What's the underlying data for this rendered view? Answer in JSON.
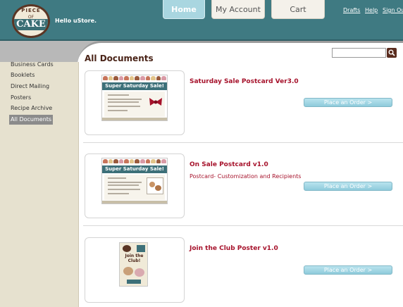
{
  "header": {
    "logo_top": "PIECE",
    "logo_mid": "OF",
    "logo_main": "CAKE",
    "greeting": "Hello uStore.",
    "tabs": [
      {
        "label": "Home"
      },
      {
        "label": "My Account"
      },
      {
        "label": "Cart"
      }
    ],
    "links": {
      "drafts": "Drafts",
      "help": "Help",
      "signout": "Sign Ou"
    }
  },
  "search": {
    "placeholder": ""
  },
  "sidebar": {
    "items": [
      {
        "label": "Business Cards"
      },
      {
        "label": "Booklets"
      },
      {
        "label": "Direct Mailing"
      },
      {
        "label": "Posters"
      },
      {
        "label": "Recipe Archive"
      },
      {
        "label": "All Documents"
      }
    ],
    "active_item": "All Documents"
  },
  "main": {
    "title": "All Documents",
    "products": [
      {
        "name": "Saturday Sale Postcard Ver3.0",
        "description": "",
        "order_label": "Place an Order >",
        "thumb_banner": "Super Saturday Sale!"
      },
      {
        "name": "On Sale Postcard v1.0",
        "description": "Postcard- Customization and Recipients",
        "order_label": "Place an Order >",
        "thumb_banner": "Super Saturday Sale!"
      },
      {
        "name": "Join the Club Poster v1.0",
        "description": "",
        "order_label": "Place an Order >",
        "thumb_banner": "Join the Club!"
      }
    ]
  },
  "colors": {
    "header_bg": "#3f7a82",
    "brand_brown": "#5a2c1e",
    "product_red": "#a6122b",
    "sidebar_bg": "#e6e1cf",
    "button_blue": "#8ecbdb"
  }
}
